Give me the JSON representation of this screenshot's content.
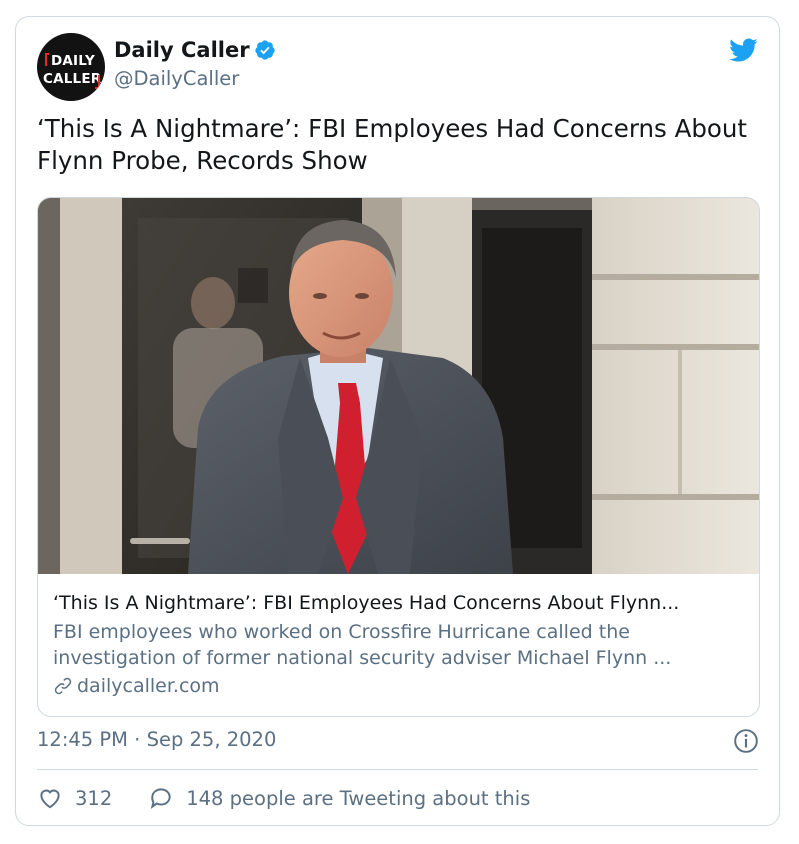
{
  "author": {
    "avatar_text_line1": "DAILY",
    "avatar_text_line2": "CALLER",
    "display_name": "Daily Caller",
    "handle": "@DailyCaller",
    "verified": true
  },
  "tweet": {
    "text": "‘This Is A Nightmare’: FBI Employees Had Concerns About Flynn Probe, Records Show"
  },
  "link_card": {
    "title": "‘This Is A Nightmare’: FBI Employees Had Concerns About Flynn...",
    "description": "FBI employees who worked on Crossfire Hurricane called the investigation of former national security adviser Michael Flynn ...",
    "domain": "dailycaller.com"
  },
  "meta": {
    "timestamp": "12:45 PM · Sep 25, 2020"
  },
  "engagement": {
    "likes": "312",
    "tweeting": "148 people are Tweeting about this"
  },
  "colors": {
    "twitter_blue": "#1da1f2",
    "secondary_text": "#5b7083",
    "border": "#cfd9de",
    "brand_red": "#e52a2a"
  },
  "icons": [
    "twitter-bird-icon",
    "verified-badge-icon",
    "link-icon",
    "info-icon",
    "heart-icon",
    "reply-icon"
  ]
}
